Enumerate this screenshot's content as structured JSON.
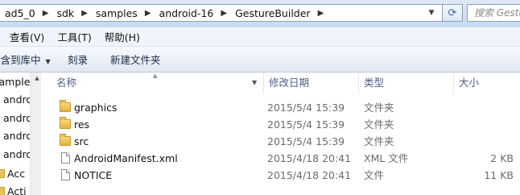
{
  "address": {
    "breadcrumbs": [
      "ad5_0",
      "sdk",
      "samples",
      "android-16",
      "GestureBuilder"
    ],
    "search_placeholder": "搜索 GestureBuilder"
  },
  "menu": [
    "查看(V)",
    "工具(T)",
    "帮助(H)"
  ],
  "toolbar": {
    "include_library": "包含到库中",
    "burn": "刻录",
    "new_folder": "新建文件夹"
  },
  "nav": {
    "items": [
      {
        "label": "samples",
        "icon": "none"
      },
      {
        "label": "android",
        "icon": "none"
      },
      {
        "label": "android",
        "icon": "none"
      },
      {
        "label": "android",
        "icon": "none"
      },
      {
        "label": "android",
        "icon": "none"
      },
      {
        "label": "Acc",
        "icon": "folder-icon"
      },
      {
        "label": "Acti",
        "icon": "folder-icon"
      }
    ]
  },
  "columns": {
    "name": "名称",
    "date": "修改日期",
    "type": "类型",
    "size": "大小"
  },
  "files": [
    {
      "name": "graphics",
      "date": "2015/5/4 15:39",
      "type": "文件夹",
      "size": "",
      "icon": "folder-icon"
    },
    {
      "name": "res",
      "date": "2015/5/4 15:39",
      "type": "文件夹",
      "size": "",
      "icon": "folder-icon"
    },
    {
      "name": "src",
      "date": "2015/5/4 15:39",
      "type": "文件夹",
      "size": "",
      "icon": "folder-icon"
    },
    {
      "name": "AndroidManifest.xml",
      "date": "2015/4/18 20:41",
      "type": "XML 文件",
      "size": "2 KB",
      "icon": "file-icon"
    },
    {
      "name": "NOTICE",
      "date": "2015/4/18 20:41",
      "type": "文件",
      "size": "11 KB",
      "icon": "file-icon"
    }
  ]
}
